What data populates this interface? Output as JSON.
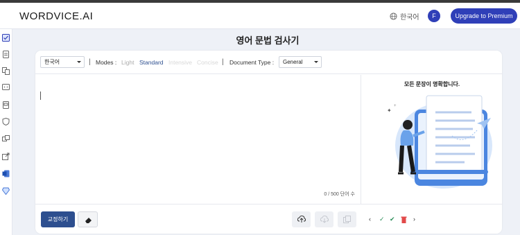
{
  "app": {
    "logo": "WORDVICE.AI"
  },
  "header": {
    "language_label": "한국어",
    "avatar_initial": "F",
    "upgrade_label": "Upgrade to Premium"
  },
  "page_title": "영어 문법 검사기",
  "toolbar": {
    "language_select": "한국어",
    "modes_label": "Modes :",
    "modes": [
      "Light",
      "Standard",
      "Intensive",
      "Concise"
    ],
    "active_mode": "Standard",
    "document_type_label": "Document Type :",
    "document_type": "General"
  },
  "editor": {
    "counter": "0 / 500 단어 수"
  },
  "illustration": {
    "message": "모든 문장이 명확합니다."
  },
  "bottom": {
    "correct_label": "교정하기"
  },
  "colors": {
    "brand": "#2f3fb8",
    "accent": "#2d4f8f"
  }
}
